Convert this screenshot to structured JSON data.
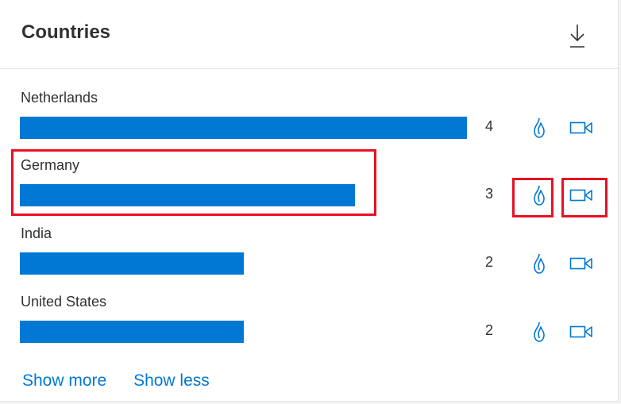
{
  "panel": {
    "title": "Countries",
    "download_icon": "download-icon"
  },
  "rows": [
    {
      "country": "Netherlands",
      "count": "4",
      "bar_fraction": 1.0
    },
    {
      "country": "Germany",
      "count": "3",
      "bar_fraction": 0.75
    },
    {
      "country": "India",
      "count": "2",
      "bar_fraction": 0.5
    },
    {
      "country": "United States",
      "count": "2",
      "bar_fraction": 0.5
    }
  ],
  "row_icons": {
    "flame": "flame-icon",
    "video": "video-camera-icon"
  },
  "footer": {
    "show_more": "Show more",
    "show_less": "Show less"
  },
  "colors": {
    "bar": "#0078d4",
    "link": "#0078d4",
    "highlight": "#e81123"
  }
}
